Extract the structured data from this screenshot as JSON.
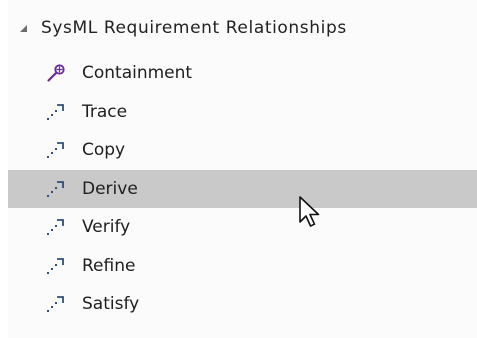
{
  "section": {
    "title": "SysML Requirement Relationships",
    "expander_icon": "triangle-expanded-icon"
  },
  "items": [
    {
      "label": "Containment",
      "icon": "containment-icon",
      "selected": false
    },
    {
      "label": "Trace",
      "icon": "dashed-arrow-icon",
      "selected": false
    },
    {
      "label": "Copy",
      "icon": "dashed-arrow-icon",
      "selected": false
    },
    {
      "label": "Derive",
      "icon": "dashed-arrow-icon",
      "selected": true
    },
    {
      "label": "Verify",
      "icon": "dashed-arrow-icon",
      "selected": false
    },
    {
      "label": "Refine",
      "icon": "dashed-arrow-icon",
      "selected": false
    },
    {
      "label": "Satisfy",
      "icon": "dashed-arrow-icon",
      "selected": false
    }
  ],
  "colors": {
    "selection_background": "#c9c9c9",
    "containment_icon": "#6a2a9a",
    "arrow_icon": "#2c4f7c"
  },
  "pointer": "mouse-pointer-icon"
}
